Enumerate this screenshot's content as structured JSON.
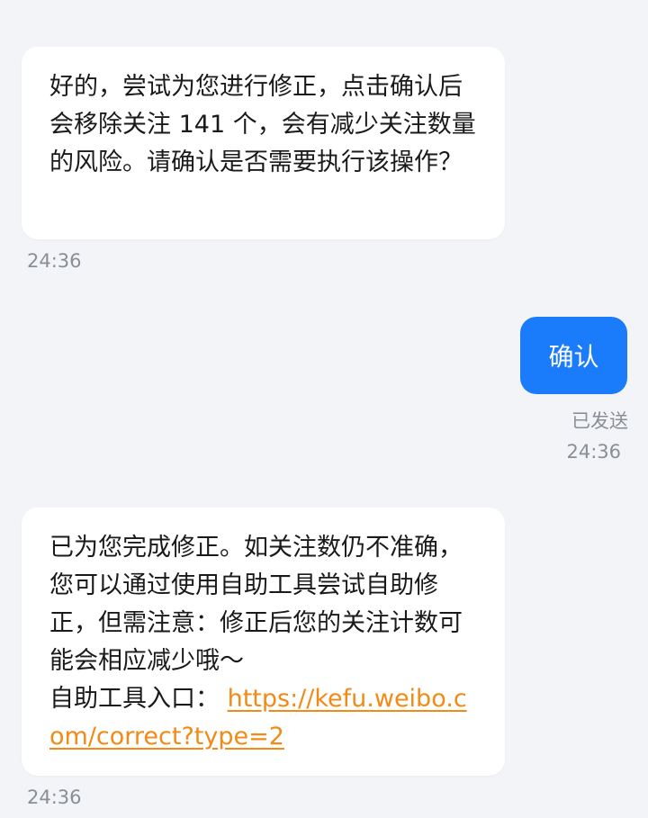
{
  "messages": [
    {
      "text": "好的，尝试为您进行修正，点击确认后会移除关注 141 个，会有减少关注数量的风险。请确认是否需要执行该操作？",
      "time": "24:36"
    },
    {
      "text": "确认",
      "status": "已发送",
      "time": "24:36"
    },
    {
      "text": "已为您完成修正。如关注数仍不准确，您可以通过使用自助工具尝试自助修正，但需注意：修正后您的关注计数可能会相应减少哦～",
      "link_prefix": "自助工具入口：",
      "link": "https://kefu.weibo.com/correct?type=2",
      "time": "24:36"
    }
  ],
  "colors": {
    "background": "#f3f4f8",
    "incoming_bubble": "#ffffff",
    "outgoing_bubble": "#1a7cfa",
    "link": "#f28a15",
    "meta_text": "#8a8e96"
  }
}
